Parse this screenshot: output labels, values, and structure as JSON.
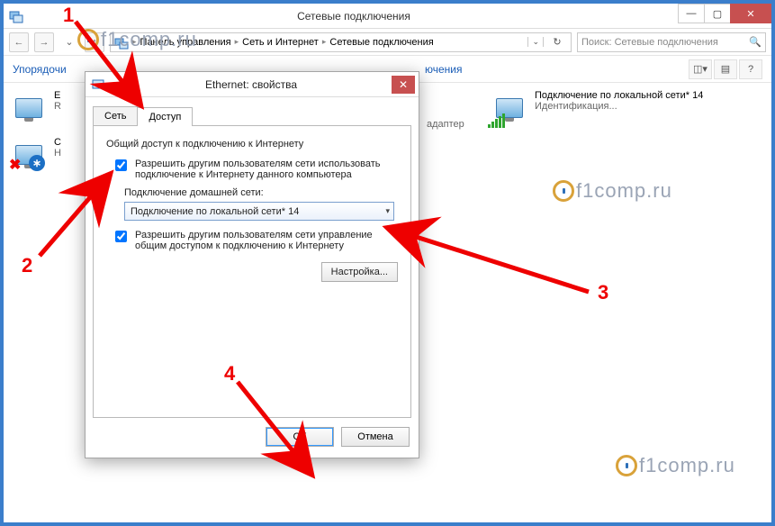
{
  "window": {
    "title": "Сетевые подключения"
  },
  "breadcrumb": {
    "items": [
      "Панель управления",
      "Сеть и Интернет",
      "Сетевые подключения"
    ]
  },
  "search": {
    "placeholder": "Поиск: Сетевые подключения"
  },
  "toolbar": {
    "sort_label_partial": "Упорядочи",
    "label_partial_2": "ючения"
  },
  "connections": [
    {
      "name": "E",
      "sub": "R",
      "type": "ethernet"
    },
    {
      "name": "С",
      "sub": "Н",
      "type": "bluetooth"
    },
    {
      "name": "адаптер",
      "sub": "",
      "type": "adapter",
      "hidden_behind_dialog": true
    },
    {
      "name": "Подключение по локальной сети* 14",
      "sub": "Идентификация...",
      "type": "wifi"
    }
  ],
  "dialog": {
    "title": "Ethernet: свойства",
    "tabs": [
      "Сеть",
      "Доступ"
    ],
    "active_tab": 1,
    "group_title": "Общий доступ к подключению к Интернету",
    "checkbox1": "Разрешить другим пользователям сети использовать подключение к Интернету данного компьютера",
    "home_net_label": "Подключение домашней сети:",
    "combo_value": "Подключение по локальной сети* 14",
    "checkbox2": "Разрешить другим пользователям сети управление общим доступом к подключению к Интернету",
    "settings_btn": "Настройка...",
    "ok_btn": "ОК",
    "cancel_btn": "Отмена"
  },
  "watermark": "f1comp.ru",
  "annotations": {
    "n1": "1",
    "n2": "2",
    "n3": "3",
    "n4": "4"
  }
}
